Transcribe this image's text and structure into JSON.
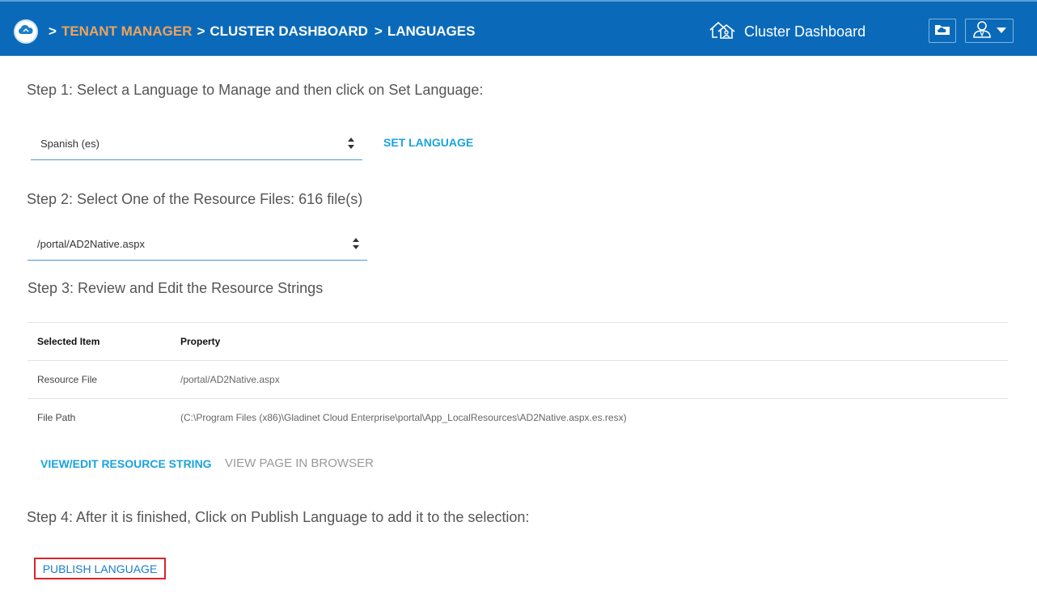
{
  "header": {
    "breadcrumb_sep": ">",
    "crumb_tenant": "TENANT MANAGER",
    "crumb_cluster": "CLUSTER DASHBOARD",
    "crumb_languages": "LANGUAGES",
    "cluster_link_label": "Cluster Dashboard"
  },
  "step1": {
    "text": "Step 1: Select a Language to Manage and then click on Set Language:",
    "selected_language": "Spanish (es)",
    "set_button": "SET LANGUAGE"
  },
  "step2": {
    "text": "Step 2: Select One of the Resource Files: 616 file(s)",
    "selected_file": "/portal/AD2Native.aspx"
  },
  "step3": {
    "text": "Step 3: Review and Edit the Resource Strings",
    "table": {
      "headers": [
        "Selected Item",
        "Property"
      ],
      "rows": [
        [
          "Resource File",
          "/portal/AD2Native.aspx"
        ],
        [
          "File Path",
          "(C:\\Program Files (x86)\\Gladinet Cloud Enterprise\\portal\\App_LocalResources\\AD2Native.aspx.es.resx)"
        ]
      ]
    },
    "edit_button": "VIEW/EDIT RESOURCE STRING",
    "view_button": "VIEW PAGE IN BROWSER"
  },
  "step4": {
    "text": "Step 4: After it is finished, Click on Publish Language to add it to the selection:",
    "publish_button": "PUBLISH LANGUAGE"
  },
  "colors": {
    "header_bg": "#0a6ab9",
    "accent": "#1aa3e0",
    "tenant_crumb": "#f0a35c",
    "highlight_border": "#d9262c"
  }
}
